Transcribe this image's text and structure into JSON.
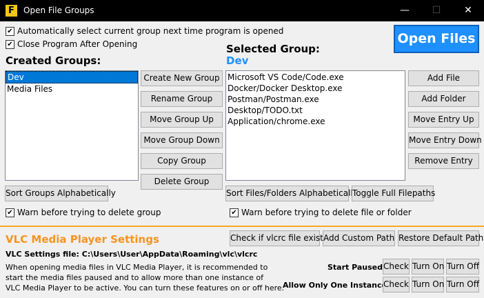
{
  "window": {
    "app_icon_letter": "F",
    "title": "Open File Groups",
    "minimize": "—",
    "maximize": "☐",
    "close": "✕"
  },
  "options": {
    "auto_select": "Automatically select current group next time program is opened",
    "close_after": "Close Program After Opening",
    "checked_glyph": "✔"
  },
  "open_files_label": "Open Files",
  "created_groups": {
    "heading": "Created Groups:",
    "items": [
      "Dev",
      "Media Files"
    ],
    "selected_index": 0
  },
  "group_buttons": {
    "create": "Create New Group",
    "rename": "Rename Group",
    "up": "Move Group Up",
    "down": "Move Group Down",
    "copy": "Copy Group",
    "delete": "Delete Group",
    "sort": "Sort Groups Alphabetically"
  },
  "warn_delete_group": "Warn before trying to delete group",
  "selected_group": {
    "heading": "Selected Group:",
    "name": "Dev",
    "name_color": "#1e90ff",
    "items": [
      "Microsoft VS Code/Code.exe",
      "Docker/Docker Desktop.exe",
      "Postman/Postman.exe",
      "Desktop/TODO.txt",
      "Application/chrome.exe"
    ]
  },
  "file_buttons": {
    "add_file": "Add File",
    "add_folder": "Add Folder",
    "up": "Move Entry Up",
    "down": "Move Entry Down",
    "remove": "Remove Entry",
    "sort": "Sort Files/Folders Alphabetically",
    "toggle": "Toggle Full Filepaths"
  },
  "warn_delete_file": "Warn before trying to delete file or folder",
  "vlc": {
    "title": "VLC Media Player Settings",
    "title_color": "#f7931e",
    "check_exists": "Check if vlcrc file exists",
    "add_custom": "Add Custom Path",
    "restore_default": "Restore Default Path",
    "settings_file": "VLC Settings file: C:\\Users\\User\\AppData\\Roaming\\vlc\\vlcrc",
    "desc_line1": "When opening media files in VLC Media Player, it is recommended to",
    "desc_line2": "start the media files paused and to allow more than one instance of",
    "desc_line3": "VLC Media Player to be active. You can turn these features on or off here.",
    "start_paused": "Start Paused:",
    "one_instance": "Allow Only One Instance:",
    "check": "Check",
    "turn_on": "Turn On",
    "turn_off": "Turn Off"
  }
}
